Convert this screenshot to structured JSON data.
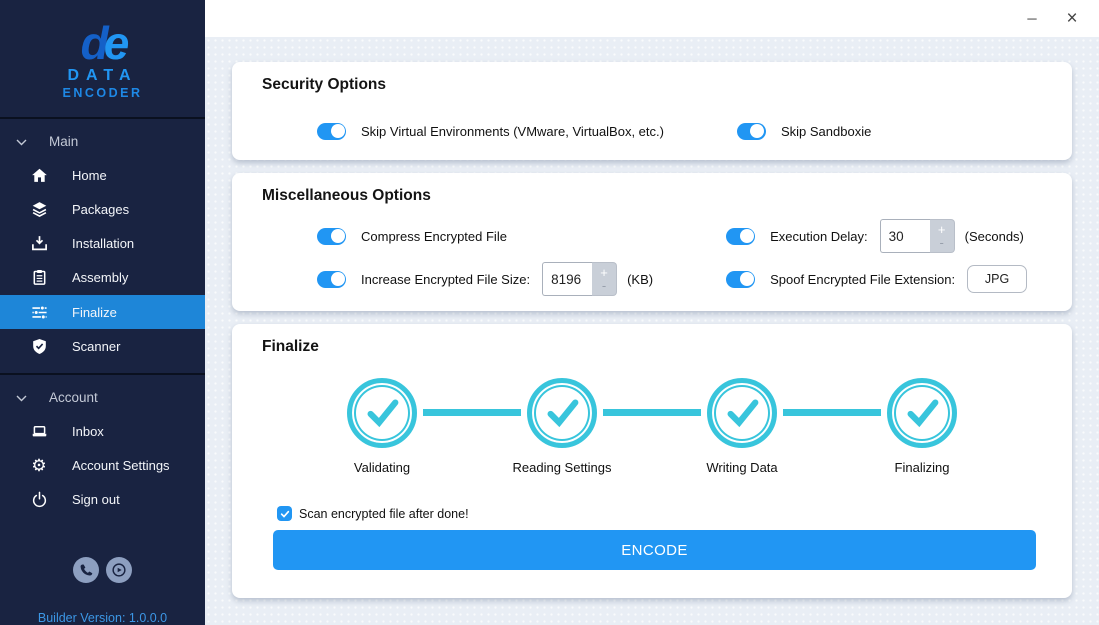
{
  "window": {
    "minimize_glyph": "─",
    "close_glyph": "×"
  },
  "sidebar": {
    "logo": {
      "monogram_d": "d",
      "monogram_e": "e",
      "word_top": "DATA",
      "word_bottom": "ENCODER"
    },
    "sections": [
      {
        "label": "Main",
        "items": [
          {
            "label": "Home"
          },
          {
            "label": "Packages"
          },
          {
            "label": "Installation"
          },
          {
            "label": "Assembly"
          },
          {
            "label": "Finalize",
            "active": true
          },
          {
            "label": "Scanner"
          }
        ]
      },
      {
        "label": "Account",
        "items": [
          {
            "label": "Inbox"
          },
          {
            "label": "Account Settings"
          },
          {
            "label": "Sign out"
          }
        ]
      }
    ],
    "version": "Builder Version: 1.0.0.0"
  },
  "security": {
    "title": "Security Options",
    "toggle_vm": {
      "label": "Skip Virtual Environments (VMware, VirtualBox, etc.)",
      "on": true
    },
    "toggle_sandboxie": {
      "label": "Skip Sandboxie",
      "on": true
    }
  },
  "misc": {
    "title": "Miscellaneous Options",
    "compress": {
      "label": "Compress Encrypted File",
      "on": true
    },
    "delay": {
      "label": "Execution Delay:",
      "value": "30",
      "unit": "(Seconds)",
      "on": true
    },
    "size": {
      "label": "Increase Encrypted File Size:",
      "value": "8196",
      "unit": "(KB)",
      "on": true
    },
    "spoof": {
      "label": "Spoof Encrypted File Extension:",
      "value": "JPG",
      "on": true
    },
    "spinner_up": "+",
    "spinner_down": "-"
  },
  "finalize": {
    "title": "Finalize",
    "steps": [
      {
        "label": "Validating"
      },
      {
        "label": "Reading Settings"
      },
      {
        "label": "Writing Data"
      },
      {
        "label": "Finalizing"
      }
    ],
    "scan": {
      "label": "Scan encrypted file after done!",
      "checked": true
    },
    "encode_label": "ENCODE"
  },
  "colors": {
    "accent": "#2196f3",
    "nav_active": "#1e86d8",
    "step_cyan": "#38c5dc",
    "sidebar_bg": "#192341",
    "content_bg": "#e9eef5"
  }
}
